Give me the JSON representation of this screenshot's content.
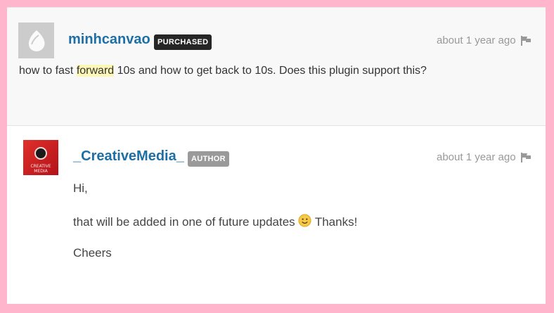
{
  "comments": [
    {
      "username": "minhcanvao",
      "badge": "PURCHASED",
      "time": "about 1 year ago",
      "body_before": "how to fast ",
      "body_highlight": "forward",
      "body_after": " 10s and how to get back to 10s. Does this plugin support this?"
    }
  ],
  "reply": {
    "username": "_CreativeMedia_",
    "badge": "AUTHOR",
    "time": "about 1 year ago",
    "avatar_text": "CREATIVE MEDIA",
    "line1": "Hi,",
    "line2_before": "that will be added in one of future updates",
    "line2_after": " Thanks!",
    "line3": "Cheers"
  },
  "colors": {
    "page_border": "#ffb6cc",
    "username": "#1d6fa5",
    "highlight": "#fcf7b6",
    "purchased_badge": "#262626",
    "author_badge": "#9a9a9a"
  },
  "icons": {
    "flag": "flag-icon",
    "smiley": "smiley-emoji-icon"
  }
}
